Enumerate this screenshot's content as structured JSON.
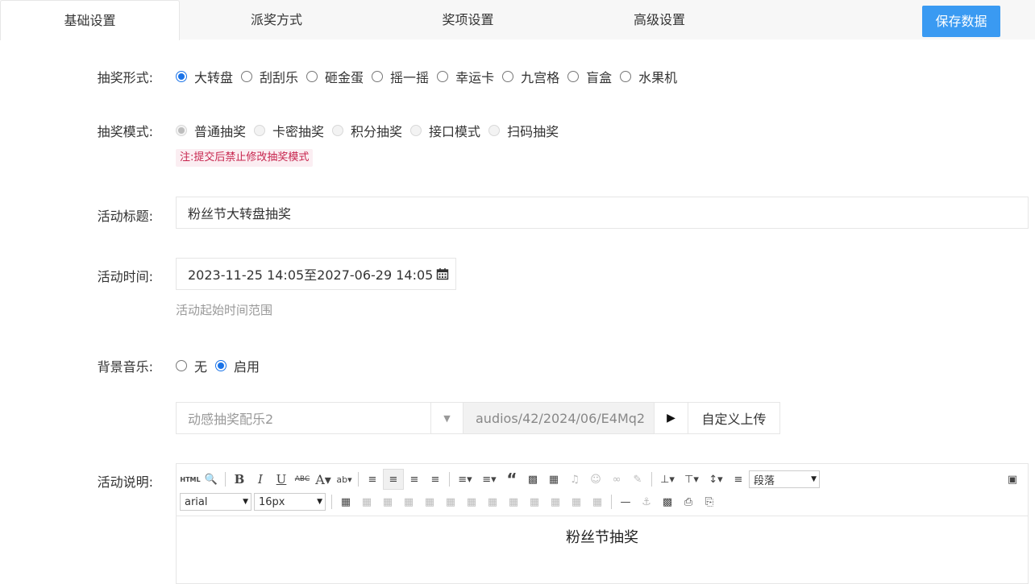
{
  "tabs": [
    {
      "label": "基础设置"
    },
    {
      "label": "派奖方式"
    },
    {
      "label": "奖项设置"
    },
    {
      "label": "高级设置"
    }
  ],
  "save_button": "保存数据",
  "lottery_form": {
    "label": "抽奖形式:",
    "options": [
      "大转盘",
      "刮刮乐",
      "砸金蛋",
      "摇一摇",
      "幸运卡",
      "九宫格",
      "盲盒",
      "水果机"
    ],
    "selected": "大转盘"
  },
  "lottery_mode": {
    "label": "抽奖模式:",
    "options": [
      "普通抽奖",
      "卡密抽奖",
      "积分抽奖",
      "接口模式",
      "扫码抽奖"
    ],
    "selected": "普通抽奖",
    "note": "注:提交后禁止修改抽奖模式"
  },
  "activity_title": {
    "label": "活动标题:",
    "value": "粉丝节大转盘抽奖"
  },
  "activity_time": {
    "label": "活动时间:",
    "value": "2023-11-25 14:05至2027-06-29 14:05",
    "hint": "活动起始时间范围",
    "icon": "calendar-icon"
  },
  "bg_music": {
    "label": "背景音乐:",
    "options": [
      "无",
      "启用"
    ],
    "selected": "启用",
    "music_name": "动感抽奖配乐2",
    "music_path": "audios/42/2024/06/E4Mq2",
    "upload_label": "自定义上传"
  },
  "description": {
    "label": "活动说明:",
    "font_family": "arial",
    "font_size": "16px",
    "paragraph": "段落",
    "html_label": "HTML",
    "content": "粉丝节抽奖"
  },
  "colors": {
    "accent": "#3a9af2",
    "radio_checked": "#1a73e8",
    "note_text": "#c7254e",
    "note_bg": "#fbeef2"
  }
}
